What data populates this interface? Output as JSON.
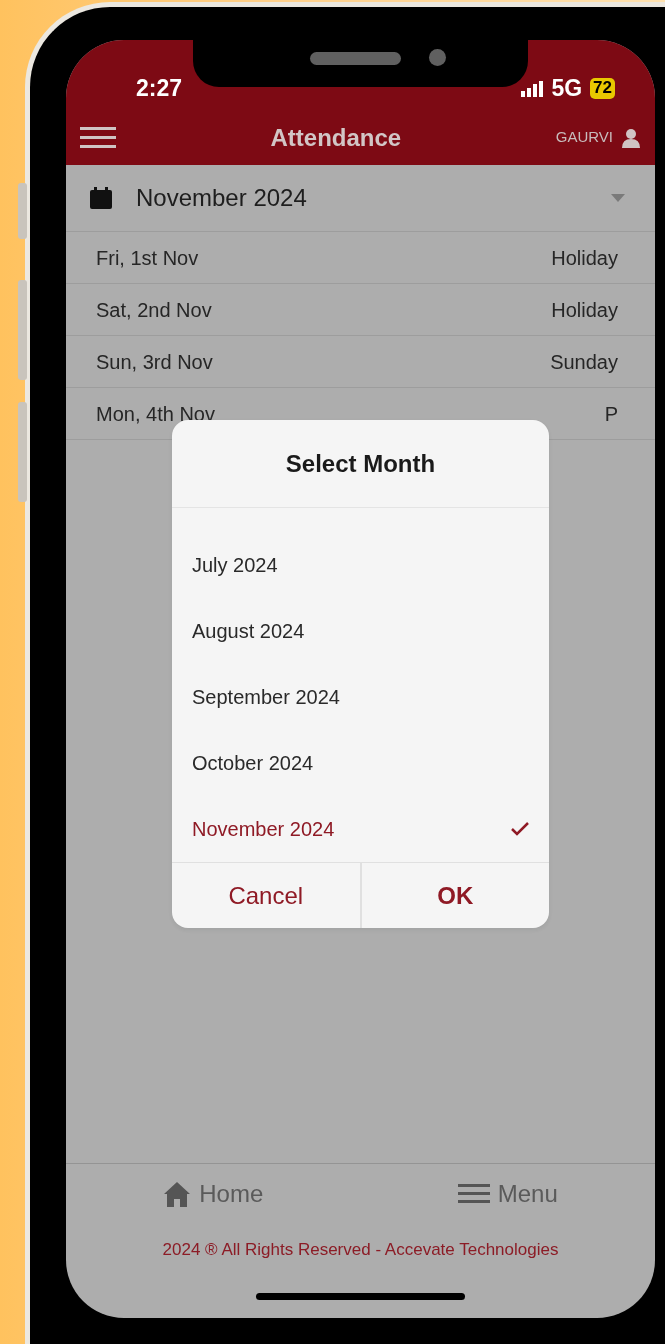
{
  "status_bar": {
    "time": "2:27",
    "network": "5G",
    "battery": "72"
  },
  "header": {
    "title": "Attendance",
    "user": "GAURVI"
  },
  "month_picker": {
    "value": "November 2024"
  },
  "days": [
    {
      "date": "Fri, 1st Nov",
      "status": "Holiday"
    },
    {
      "date": "Sat, 2nd Nov",
      "status": "Holiday"
    },
    {
      "date": "Sun, 3rd Nov",
      "status": "Sunday"
    },
    {
      "date": "Mon, 4th Nov",
      "status": "P"
    }
  ],
  "dialog": {
    "title": "Select Month",
    "options": [
      {
        "label": "July 2024",
        "selected": false
      },
      {
        "label": "August 2024",
        "selected": false
      },
      {
        "label": "September 2024",
        "selected": false
      },
      {
        "label": "October 2024",
        "selected": false
      },
      {
        "label": "November 2024",
        "selected": true
      }
    ],
    "buttons": [
      {
        "label": "Cancel",
        "kind": "cancel"
      },
      {
        "label": "OK",
        "kind": "confirm"
      }
    ]
  },
  "bottom_nav": [
    {
      "label": "Home",
      "kind": "home"
    },
    {
      "label": "Menu",
      "kind": "menu"
    }
  ],
  "footer": "2024 ® All Rights Reserved - Accevate Technologies"
}
